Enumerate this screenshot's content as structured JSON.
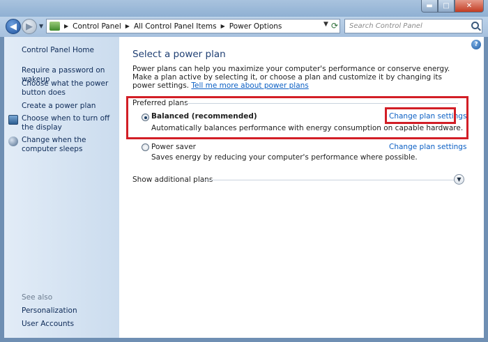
{
  "window": {
    "controls": {
      "minimize": "▬",
      "maximize": "□",
      "close": "✕"
    }
  },
  "address": {
    "crumbs": [
      "Control Panel",
      "All Control Panel Items",
      "Power Options"
    ],
    "search_placeholder": "Search Control Panel"
  },
  "sidebar": {
    "home": "Control Panel Home",
    "links": [
      "Require a password on wakeup",
      "Choose what the power button does",
      "Create a power plan",
      "Choose when to turn off the display",
      "Change when the computer sleeps"
    ],
    "see_also_label": "See also",
    "see_also": [
      "Personalization",
      "User Accounts"
    ]
  },
  "main": {
    "help": "?",
    "title": "Select a power plan",
    "intro_text": "Power plans can help you maximize your computer's performance or conserve energy. Make a plan active by selecting it, or choose a plan and customize it by changing its power settings.",
    "intro_link": "Tell me more about power plans",
    "group_label": "Preferred plans",
    "plans": [
      {
        "name": "Balanced (recommended)",
        "selected": true,
        "description": "Automatically balances performance with energy consumption on capable hardware.",
        "link": "Change plan settings"
      },
      {
        "name": "Power saver",
        "selected": false,
        "description": "Saves energy by reducing your computer's performance where possible.",
        "link": "Change plan settings"
      }
    ],
    "show_additional": "Show additional plans"
  },
  "colors": {
    "highlight": "#d21e26",
    "link": "#0b5fc4",
    "title": "#1f3f73"
  }
}
